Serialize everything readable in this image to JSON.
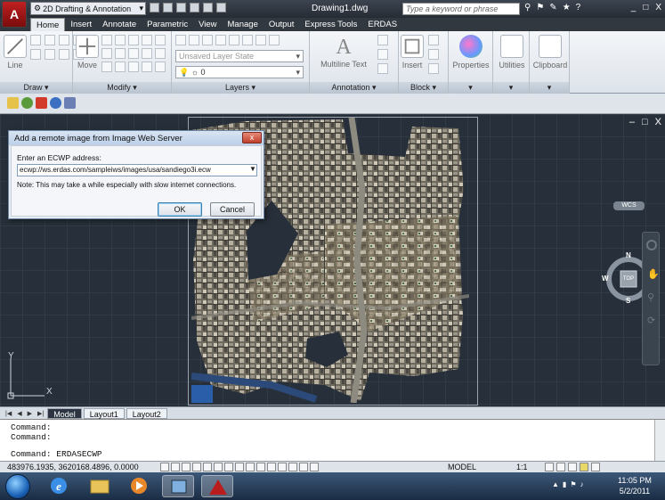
{
  "window": {
    "app_letter": "A",
    "workspace": "2D Drafting & Annotation",
    "title": "Drawing1.dwg",
    "search_placeholder": "Type a keyword or phrase",
    "minimize": "_",
    "restore": "□",
    "close": "X"
  },
  "ribbon_tabs": [
    "Home",
    "Insert",
    "Annotate",
    "Parametric",
    "View",
    "Manage",
    "Output",
    "Express Tools",
    "ERDAS"
  ],
  "ribbon": {
    "draw": {
      "label": "Draw",
      "line": "Line"
    },
    "modify": {
      "label": "Modify",
      "move": "Move"
    },
    "layers": {
      "label": "Layers",
      "layer_state": "Unsaved Layer State",
      "current_layer": "0"
    },
    "annotation": {
      "label": "Annotation",
      "multiline_text": "Multiline Text",
      "letter": "A"
    },
    "block": {
      "label": "Block",
      "insert": "Insert"
    },
    "properties": "Properties",
    "utilities": "Utilities",
    "clipboard": "Clipboard"
  },
  "viewport": {
    "minimize": "–",
    "restore": "□",
    "close": "X"
  },
  "dialog": {
    "title": "Add a remote image from Image Web Server",
    "close": "x",
    "label": "Enter an ECWP address:",
    "address": "ecwp://ws.erdas.com/sampleiws/images/usa/sandiego3i.ecw",
    "note": "Note: This may take a while especially with slow internet connections.",
    "ok": "OK",
    "cancel": "Cancel"
  },
  "viewcube": {
    "n": "N",
    "s": "S",
    "e": "E",
    "w": "W",
    "face": "TOP",
    "wcs": "WCS"
  },
  "ucs": {
    "x": "X",
    "y": "Y"
  },
  "layout_tabs": [
    "Model",
    "Layout1",
    "Layout2"
  ],
  "command": {
    "history": [
      "Command:",
      "Command:"
    ],
    "current": "Command: ERDASECWP"
  },
  "status": {
    "coords": "483976.1935, 3620168.4896, 0.0000",
    "model": "MODEL",
    "scale": "1:1"
  },
  "taskbar": {
    "time": "11:05 PM",
    "date": "5/2/2011"
  },
  "colors": {
    "drawing_bg": "#27303a",
    "ribbon_tab_bar": "#31383f",
    "autocad_red": "#b81c1c"
  }
}
